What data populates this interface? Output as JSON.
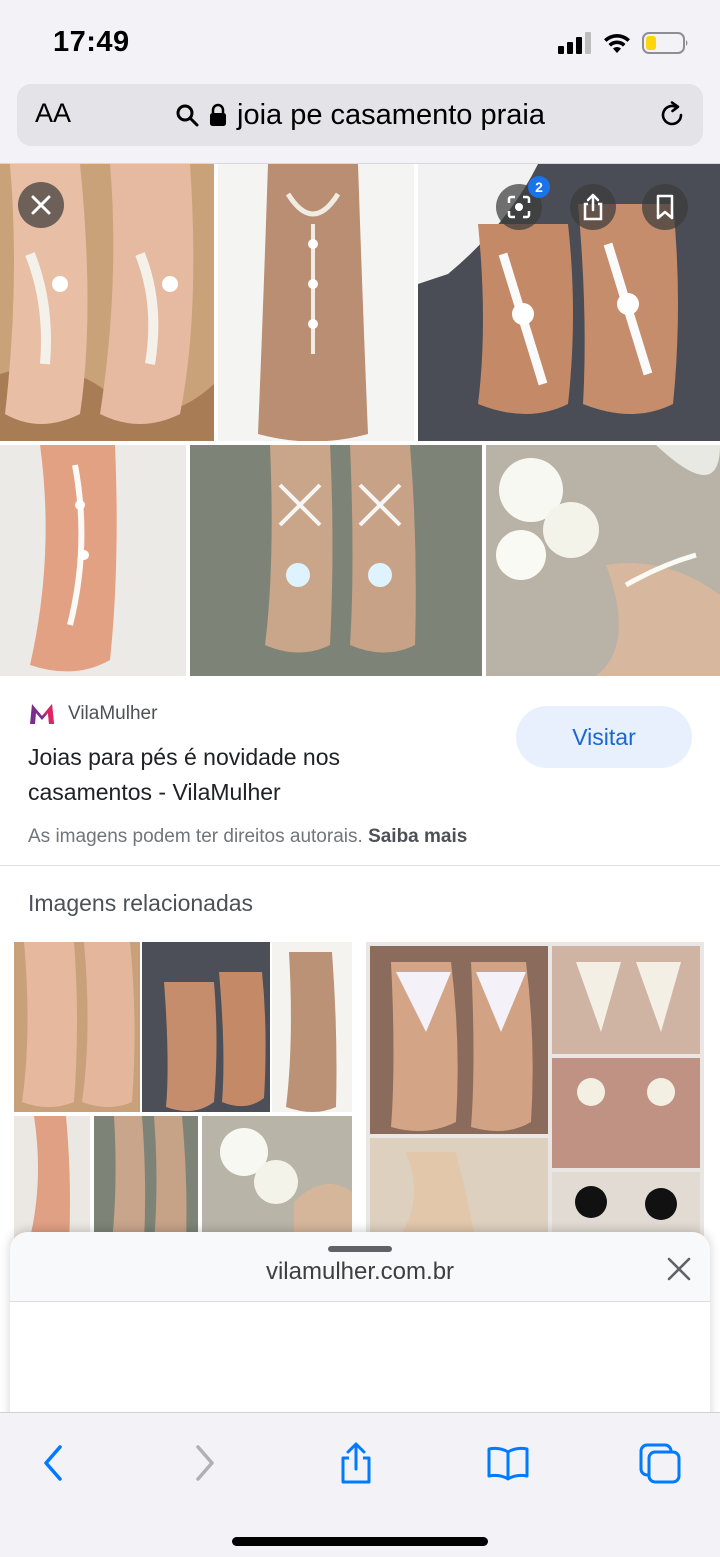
{
  "status": {
    "time": "17:49"
  },
  "browser": {
    "text_size_label": "AA",
    "url_query": "joia pe casamento praia"
  },
  "hero": {
    "lens_badge_count": "2"
  },
  "result": {
    "source_name": "VilaMulher",
    "title": "Joias para pés é novidade nos casamentos - VilaMulher",
    "visit_label": "Visitar",
    "copyright_text": "As imagens podem ter direitos autorais.",
    "learn_more_label": "Saiba mais"
  },
  "related": {
    "heading": "Imagens relacionadas"
  },
  "sheet": {
    "domain": "vilamulher.com.br"
  },
  "colors": {
    "accent": "#1a73e8",
    "visit_bg": "#e8f0fe",
    "visit_text": "#1967d2",
    "battery_fill": "#ffd60a",
    "toolbar_icon": "#007aff"
  },
  "icons": [
    "signal-icon",
    "wifi-icon",
    "battery-icon",
    "search-icon",
    "lock-icon",
    "reload-icon",
    "close-icon",
    "lens-icon",
    "share-icon",
    "bookmark-icon",
    "back-icon",
    "forward-icon",
    "book-icon",
    "tabs-icon"
  ]
}
